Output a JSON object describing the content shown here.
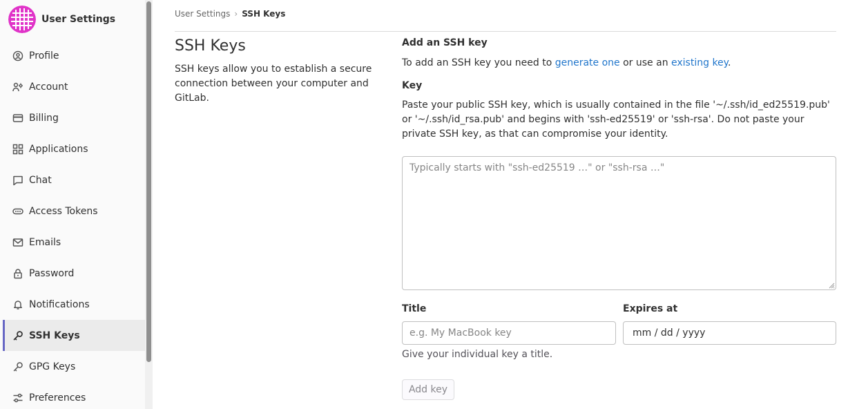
{
  "app": {
    "title": "User Settings"
  },
  "sidebar": {
    "items": [
      {
        "label": "Profile",
        "icon": "profile-icon"
      },
      {
        "label": "Account",
        "icon": "account-icon"
      },
      {
        "label": "Billing",
        "icon": "billing-icon"
      },
      {
        "label": "Applications",
        "icon": "applications-icon"
      },
      {
        "label": "Chat",
        "icon": "chat-icon"
      },
      {
        "label": "Access Tokens",
        "icon": "token-icon"
      },
      {
        "label": "Emails",
        "icon": "mail-icon"
      },
      {
        "label": "Password",
        "icon": "lock-icon"
      },
      {
        "label": "Notifications",
        "icon": "bell-icon"
      },
      {
        "label": "SSH Keys",
        "icon": "key-icon",
        "active": true
      },
      {
        "label": "GPG Keys",
        "icon": "key-icon"
      },
      {
        "label": "Preferences",
        "icon": "preferences-icon"
      }
    ]
  },
  "breadcrumb": {
    "parent": "User Settings",
    "current": "SSH Keys"
  },
  "page": {
    "title": "SSH Keys",
    "description": "SSH keys allow you to establish a secure connection between your computer and GitLab."
  },
  "form": {
    "section_title": "Add an SSH key",
    "intro_prefix": "To add an SSH key you need to ",
    "link_generate": "generate one",
    "intro_middle": " or use an ",
    "link_existing": "existing key",
    "intro_suffix": ".",
    "key_label": "Key",
    "key_help": "Paste your public SSH key, which is usually contained in the file '~/.ssh/id_ed25519.pub' or '~/.ssh/id_rsa.pub' and begins with 'ssh-ed25519' or 'ssh-rsa'. Do not paste your private SSH key, as that can compromise your identity.",
    "key_placeholder": "Typically starts with \"ssh-ed25519 …\" or \"ssh-rsa …\"",
    "title_label": "Title",
    "title_placeholder": "e.g. My MacBook key",
    "expires_label": "Expires at",
    "expires_value": "mm / dd / yyyy",
    "title_help": "Give your individual key a title.",
    "submit_label": "Add key"
  },
  "colors": {
    "accent": "#6666c4",
    "link": "#1f75cb",
    "avatar": "#e033c8"
  }
}
